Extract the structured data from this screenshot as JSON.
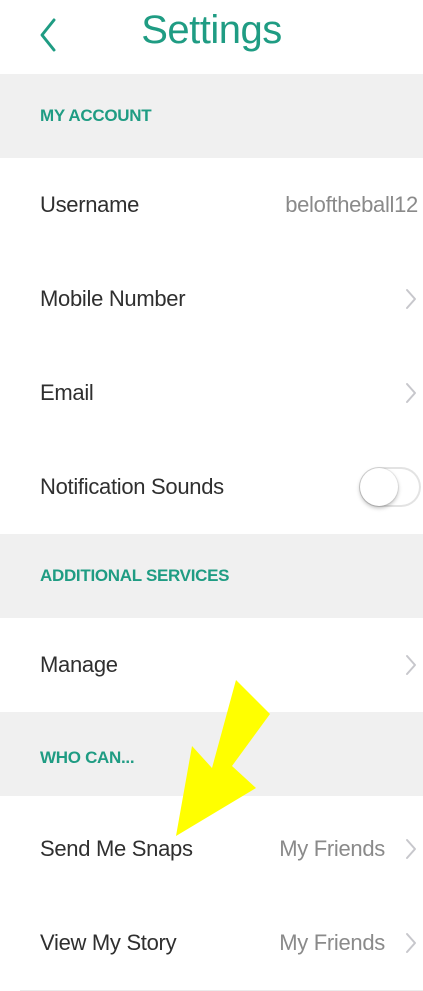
{
  "header": {
    "title": "Settings",
    "back_icon": "chevron-left-icon"
  },
  "colors": {
    "accent": "#1f9c83",
    "section_bg": "#f0f0f0",
    "annotation_arrow": "#ffff00"
  },
  "sections": {
    "my_account": {
      "title": "MY ACCOUNT",
      "rows": {
        "username": {
          "label": "Username",
          "value": "beloftheball12"
        },
        "mobile": {
          "label": "Mobile Number",
          "icon": "chevron-right-icon"
        },
        "email": {
          "label": "Email",
          "icon": "chevron-right-icon"
        },
        "notification_sounds": {
          "label": "Notification Sounds",
          "toggle": "off"
        }
      }
    },
    "additional_services": {
      "title": "ADDITIONAL SERVICES",
      "rows": {
        "manage": {
          "label": "Manage",
          "icon": "chevron-right-icon"
        }
      }
    },
    "who_can": {
      "title": "WHO CAN...",
      "rows": {
        "send_me_snaps": {
          "label": "Send Me Snaps",
          "value": "My Friends",
          "icon": "chevron-right-icon"
        },
        "view_my_story": {
          "label": "View My Story",
          "value": "My Friends",
          "icon": "chevron-right-icon"
        }
      }
    }
  }
}
